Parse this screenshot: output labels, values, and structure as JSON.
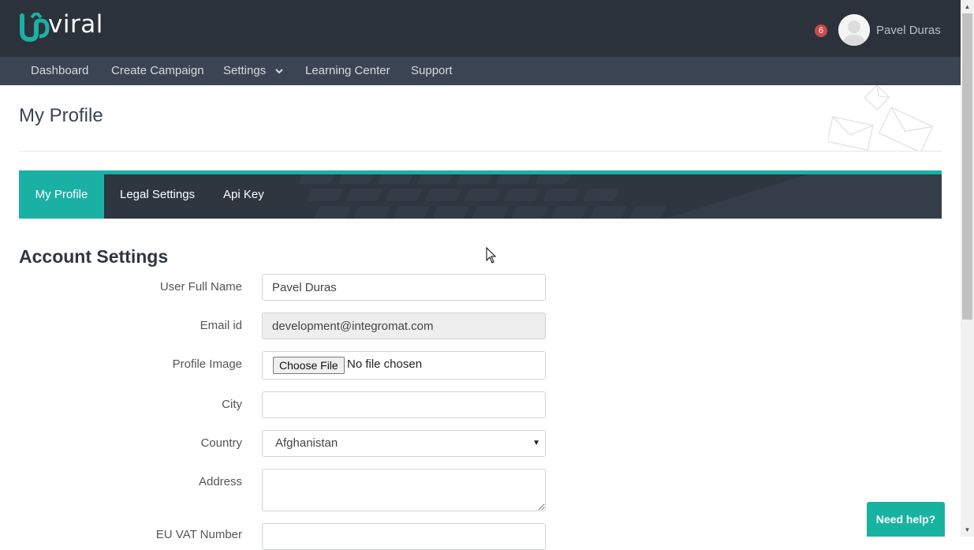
{
  "header": {
    "logo_text": "viral",
    "notification_count": "6",
    "username": "Pavel Duras"
  },
  "nav": {
    "items": [
      {
        "label": "Dashboard"
      },
      {
        "label": "Create Campaign"
      },
      {
        "label": "Settings"
      },
      {
        "label": "Learning Center"
      },
      {
        "label": "Support"
      }
    ]
  },
  "page": {
    "title": "My Profile"
  },
  "tabs": [
    {
      "label": "My Profile",
      "active": true
    },
    {
      "label": "Legal Settings",
      "active": false
    },
    {
      "label": "Api Key",
      "active": false
    }
  ],
  "form": {
    "section_title": "Account Settings",
    "full_name": {
      "label": "User Full Name",
      "value": "Pavel Duras"
    },
    "email": {
      "label": "Email id",
      "value": "development@integromat.com"
    },
    "profile_image": {
      "label": "Profile Image",
      "button": "Choose File",
      "status": "No file chosen"
    },
    "city": {
      "label": "City",
      "value": ""
    },
    "country": {
      "label": "Country",
      "value": "Afghanistan"
    },
    "address": {
      "label": "Address",
      "value": ""
    },
    "vat": {
      "label": "EU VAT Number",
      "value": ""
    }
  },
  "help": {
    "label": "Need help?"
  },
  "colors": {
    "accent": "#1ab1a4",
    "topbar": "#2b323c",
    "navbar": "#3a4452",
    "badge": "#c94b4b"
  }
}
